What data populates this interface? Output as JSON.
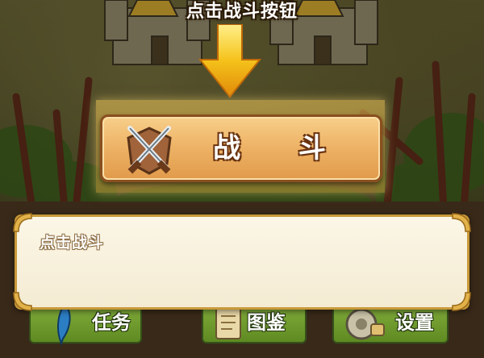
{
  "hint": {
    "text": "点击战斗按钮"
  },
  "battle_button": {
    "label": "战 斗"
  },
  "dialog": {
    "text": "点击战斗"
  },
  "menu": [
    {
      "label": "任务",
      "icon": "quest-quill-icon"
    },
    {
      "label": "图鉴",
      "icon": "codex-scroll-icon"
    },
    {
      "label": "设置",
      "icon": "settings-gear-icon"
    }
  ],
  "colors": {
    "button_orange": "#eeb468",
    "button_border": "#8a4f1f",
    "menu_green": "#6f9a2c",
    "dialog_bg": "#fbf6e6",
    "dialog_border": "#c89a3a",
    "arrow_yellow": "#f5c21a"
  }
}
